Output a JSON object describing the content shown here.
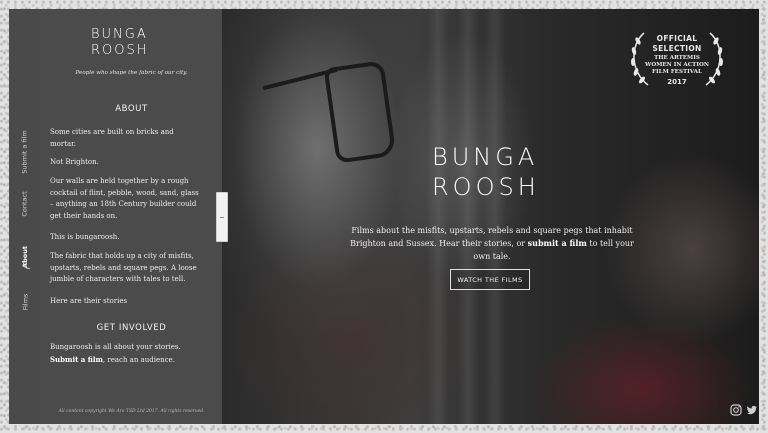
{
  "nav": {
    "items": [
      {
        "label": "Submit a film"
      },
      {
        "label": "Contact"
      },
      {
        "label": "About"
      },
      {
        "label": "Films"
      }
    ]
  },
  "logo": {
    "line1": "BUNGA",
    "line2": "ROOSH"
  },
  "tagline": "People who shape the fabric of our city.",
  "about": {
    "heading": "ABOUT",
    "p1": "Some cities are built on bricks and mortar.",
    "p2": "Not Brighton.",
    "p3": "Our walls are held together by a rough cocktail of flint, pebble, wood, sand, glass – anything an 18th Century builder could get their hands on.",
    "p4": "This is bungaroosh.",
    "p5": "The fabric that holds up a city of misfits, upstarts, rebels and square pegs. A loose jumble of characters with tales to tell.",
    "p6": "Here are their stories"
  },
  "involved": {
    "heading": "GET INVOLVED",
    "text1": "Bungaroosh is all about your stories.",
    "link": "Submit a film",
    "text2": ", reach an audience."
  },
  "copyright": "All content copyright We Are TSD Ltd 2017. All rights reserved.",
  "laurel": {
    "line1": "OFFICIAL",
    "line2": "SELECTION",
    "line3": "THE ARTEMIS",
    "line4": "WOMEN IN ACTION",
    "line5": "FILM FESTIVAL",
    "year": "2017"
  },
  "hero": {
    "logo1": "BUNGA",
    "logo2": "ROOSH",
    "text_a": "Films about the misfits, upstarts, rebels and square pegs that inhabit Brighton and Sussex. Hear their stories, or ",
    "link": "submit a film",
    "text_b": " to tell your own tale.",
    "button": "WATCH THE FILMS"
  },
  "social": {
    "instagram": "instagram-icon",
    "twitter": "twitter-icon"
  }
}
